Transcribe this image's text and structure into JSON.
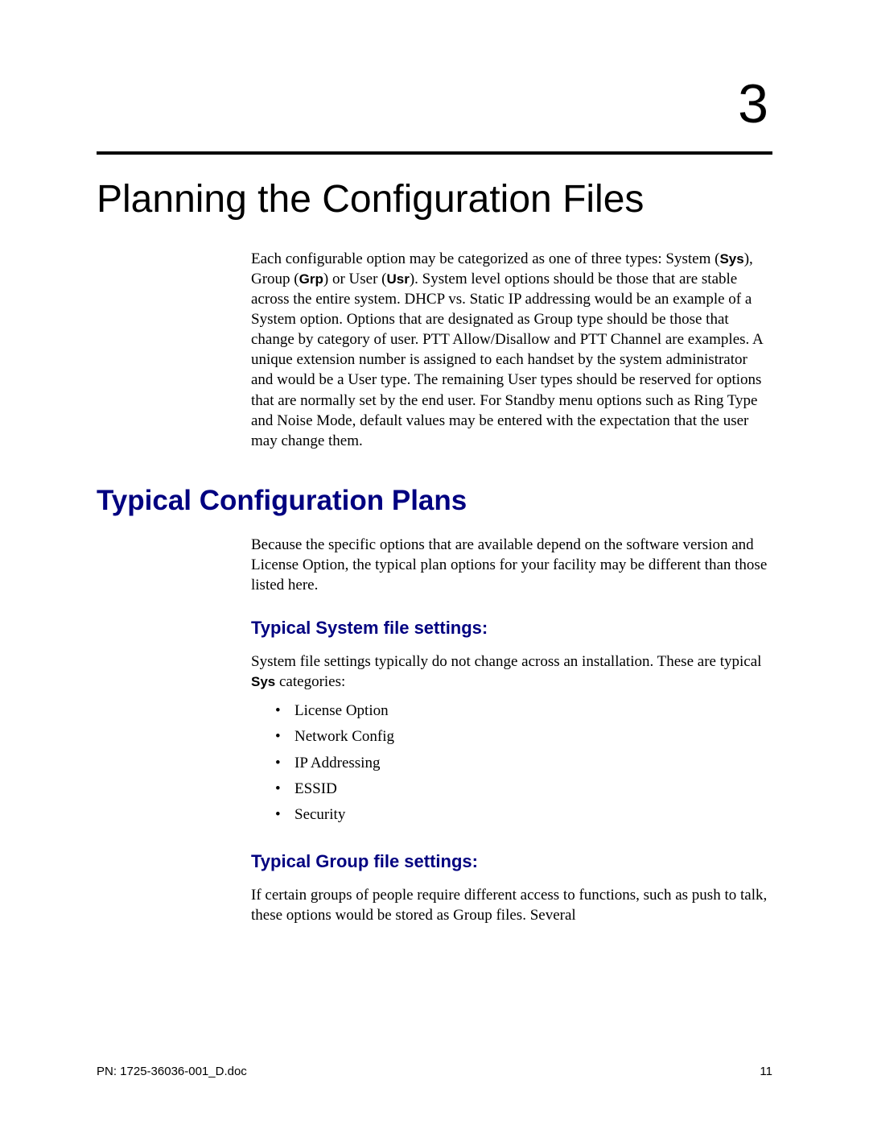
{
  "chapter": {
    "number": "3",
    "title": "Planning the Configuration Files"
  },
  "intro": {
    "seg1": "Each configurable option may be categorized as one of three types: System (",
    "sys": "Sys",
    "seg2": "), Group (",
    "grp": "Grp",
    "seg3": ") or User (",
    "usr": "Usr",
    "seg4": "). System level options should be those that are stable across the entire system. DHCP vs. Static IP addressing would be an example of a System option. Options that are designated as Group type should be those that change by category of user. PTT Allow/Disallow and PTT Channel are examples. A unique extension number is assigned to each handset by the system administrator and would be a User type. The remaining User types should be reserved for options that are normally set by the end user. For Standby menu options such as Ring Type and Noise Mode, default values may be entered with the expectation that the user may change them."
  },
  "section": {
    "heading": "Typical Configuration Plans",
    "para": "Because the specific options that are available depend on the software version and License Option, the typical plan options for your facility may be different than those listed here."
  },
  "subsection1": {
    "heading": "Typical System file settings:",
    "para_seg1": "System file settings typically do not change across an installation. These are typical ",
    "para_bold": "Sys",
    "para_seg2": " categories:",
    "items": [
      "License Option",
      "Network Config",
      "IP Addressing",
      "ESSID",
      "Security"
    ]
  },
  "subsection2": {
    "heading": "Typical Group file settings:",
    "para": "If certain groups of people require different access to functions, such as push to talk, these options would be stored as Group files. Several"
  },
  "footer": {
    "left": "PN: 1725-36036-001_D.doc",
    "right": "11"
  }
}
